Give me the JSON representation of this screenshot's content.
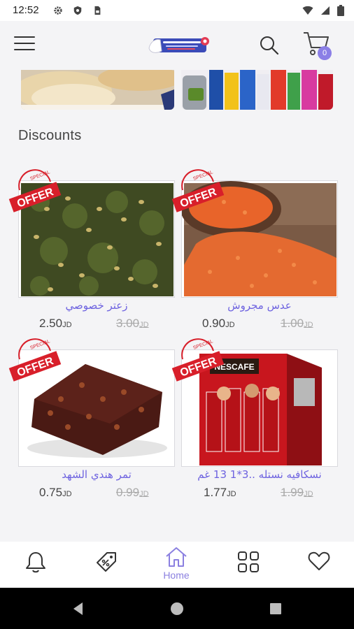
{
  "status_bar": {
    "time": "12:52"
  },
  "header": {
    "cart_count": "0"
  },
  "section": {
    "title": "Discounts"
  },
  "products": [
    {
      "name": "زعتر خصوصي",
      "price": "2.50",
      "old_price": "3.00",
      "currency": "JD",
      "image": "zaatar"
    },
    {
      "name": "عدس مجروش",
      "price": "0.90",
      "old_price": "1.00",
      "currency": "JD",
      "image": "red-lentils"
    },
    {
      "name": "تمر هندي الشهد",
      "price": "0.75",
      "old_price": "0.99",
      "currency": "JD",
      "image": "tamarind-block"
    },
    {
      "name": "نسكافيه نستله ..3*1 13 غم",
      "price": "1.77",
      "old_price": "1.99",
      "currency": "JD",
      "image": "nescafe-box"
    }
  ],
  "offer_badge": {
    "top_text": "SPECIAL",
    "main_text": "OFFER"
  },
  "bottom_nav": {
    "home_label": "Home",
    "active": "home"
  },
  "colors": {
    "accent": "#6e63e0",
    "badge": "#8b7fe6",
    "offer_red": "#d81f2a"
  }
}
